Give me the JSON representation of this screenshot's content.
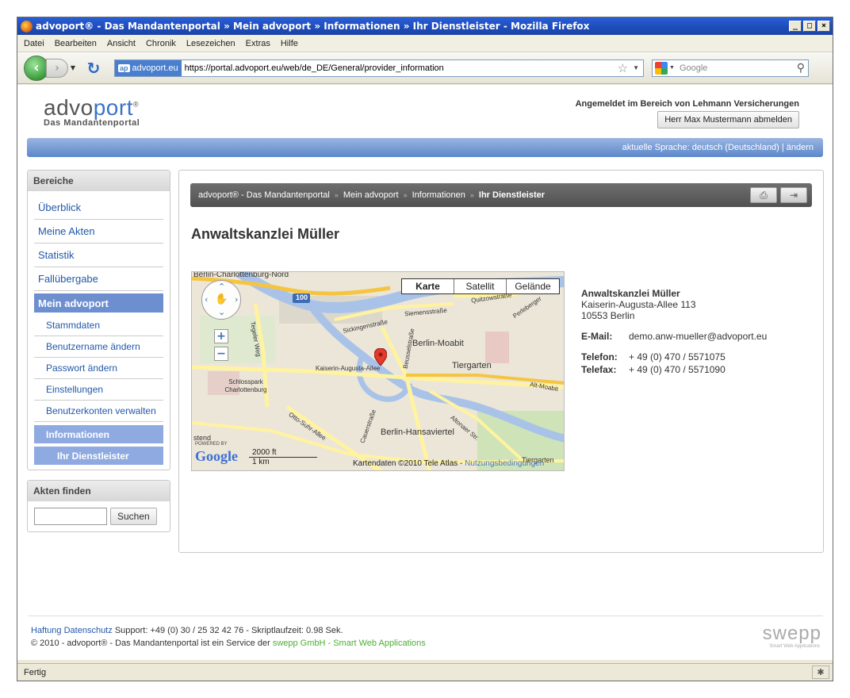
{
  "window": {
    "title": "advoport® - Das Mandantenportal » Mein advoport » Informationen » Ihr Dienstleister - Mozilla Firefox",
    "buttons": [
      "_",
      "□",
      "×"
    ]
  },
  "menu": [
    "Datei",
    "Bearbeiten",
    "Ansicht",
    "Chronik",
    "Lesezeichen",
    "Extras",
    "Hilfe"
  ],
  "navbar": {
    "site_badge": "advoport.eu",
    "url": "https://portal.advoport.eu/web/de_DE/General/provider_information",
    "search_placeholder": "Google"
  },
  "header": {
    "logo_main_a": "advo",
    "logo_main_b": "port",
    "logo_reg": "®",
    "logo_sub": "Das Mandantenportal",
    "login_info": "Angemeldet im Bereich von Lehmann Versicherungen",
    "logout_button": "Herr Max Mustermann abmelden",
    "language": "aktuelle Sprache: deutsch (Deutschland) | ändern"
  },
  "sidebar": {
    "areas_title": "Bereiche",
    "items": [
      "Überblick",
      "Meine Akten",
      "Statistik",
      "Fallübergabe"
    ],
    "active_item": "Mein advoport",
    "subitems": [
      "Stammdaten",
      "Benutzername ändern",
      "Passwort ändern",
      "Einstellungen",
      "Benutzerkonten verwalten"
    ],
    "sub_active": "Informationen",
    "sub_sub_active": "Ihr Dienstleister",
    "search_title": "Akten finden",
    "search_button": "Suchen"
  },
  "breadcrumb": {
    "items": [
      "advoport® - Das Mandantenportal",
      "Mein advoport",
      "Informationen"
    ],
    "current": "Ihr Dienstleister",
    "separator": "»"
  },
  "content": {
    "title": "Anwaltskanzlei Müller"
  },
  "map": {
    "types": [
      "Karte",
      "Satellit",
      "Gelände"
    ],
    "selected_type": "Karte",
    "labels": {
      "north": "Berlin-Charlottenburg-Nord",
      "moabit": "Berlin-Moabit",
      "tiergarten": "Tiergarten",
      "hansaviertel": "Berlin-Hansaviertel",
      "schloss": "Schlosspark Charlottenburg",
      "kaiserin": "Kaiserin-Augusta-Allee",
      "sickingen": "Sickingenstraße",
      "siemens": "Siemensstraße",
      "quitzow": "Quitzowstraße",
      "perleberg": "Perleberger",
      "tegeler": "Tegeler Weg",
      "beussel": "Beusselstraße",
      "altmoabit": "Alt-Moabit",
      "ottosuhr": "Otto-Suhr-Allee",
      "cauer": "Cauerstraße",
      "altonaer": "Altonaer Str.",
      "westend": "stend",
      "tiergarten2": "Tiergarten",
      "hwy": "100"
    },
    "scale_top": "2000 ft",
    "scale_bottom": "1 km",
    "powered": "POWERED BY",
    "google": "Google",
    "credit": "Kartendaten ©2010 Tele Atlas - ",
    "credit_link": "Nutzungsbedingungen"
  },
  "contact": {
    "name": "Anwaltskanzlei Müller",
    "street": "Kaiserin-Augusta-Allee 113",
    "city": "10553 Berlin",
    "email_label": "E-Mail:",
    "email": "demo.anw-mueller@advoport.eu",
    "phone_label": "Telefon:",
    "phone": "+ 49 (0) 470 / 5571075",
    "fax_label": "Telefax:",
    "fax": "+ 49 (0) 470 / 5571090"
  },
  "footer": {
    "link1": "Haftung",
    "link2": "Datenschutz",
    "support": "Support: +49 (0) 30 / 25 32 42 76 - Skriptlaufzeit: 0.98 Sek.",
    "copyright": "© 2010 - advoport® - Das Mandantenportal ist ein Service der ",
    "company": "swepp GmbH - Smart Web Applications",
    "logo": "swepp",
    "logo_sub": "Smart Web Applications"
  },
  "status": "Fertig",
  "colors": {
    "accent": "#3b73c8",
    "langbar": "#5c87cb",
    "active_nav": "#6d8fd0"
  }
}
